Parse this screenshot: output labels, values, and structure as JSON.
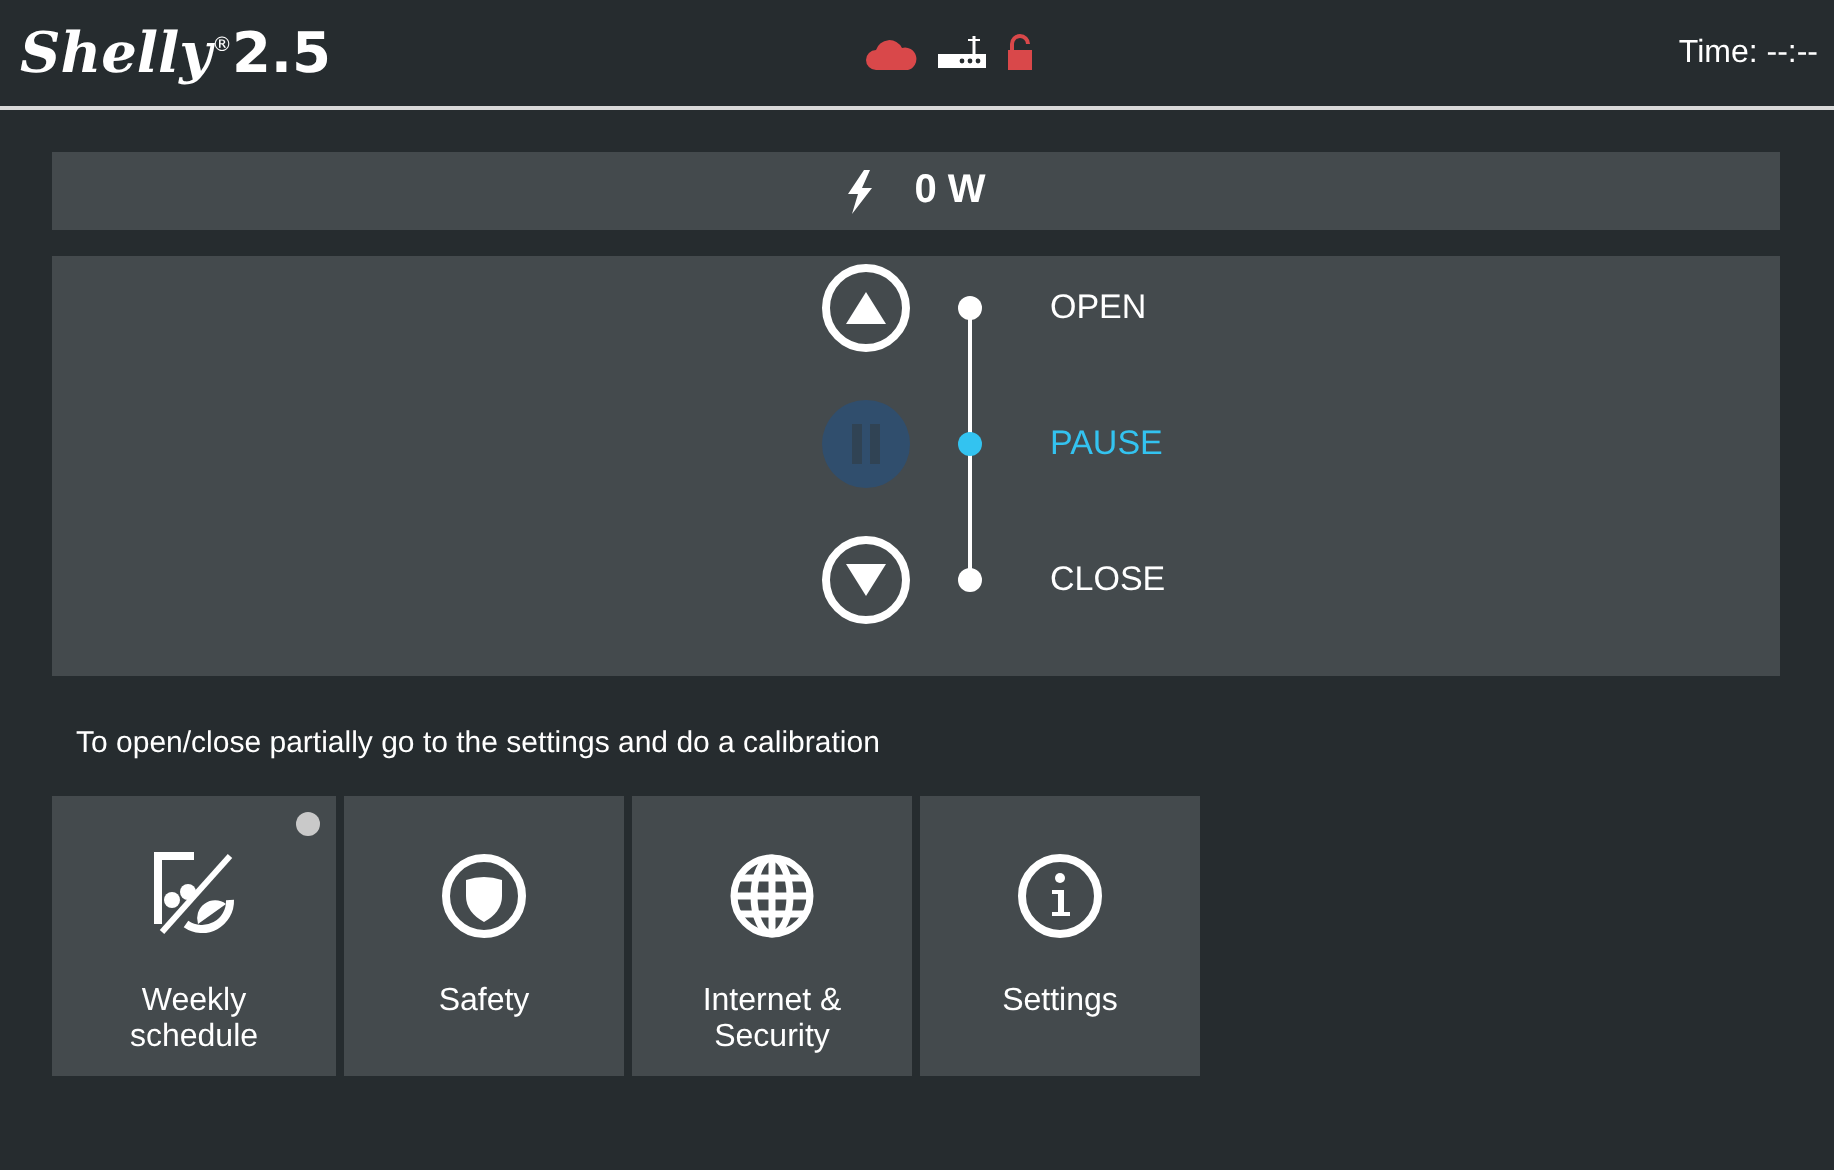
{
  "header": {
    "logo": "Shelly",
    "logo_mark": "®",
    "model": "2.5",
    "status_icons": [
      {
        "kind": "cloud",
        "color": "#d9484a"
      },
      {
        "kind": "router",
        "color": "#ffffff"
      },
      {
        "kind": "lock",
        "color": "#d9484a"
      }
    ],
    "time_label": "Time: --:--"
  },
  "power": {
    "value": "0 W"
  },
  "positions": [
    {
      "kind": "up",
      "label": "OPEN",
      "selected": false
    },
    {
      "kind": "pause",
      "label": "PAUSE",
      "selected": true
    },
    {
      "kind": "down",
      "label": "CLOSE",
      "selected": false
    }
  ],
  "hint": "To open/close partially go to the settings and do a calibration",
  "tiles": [
    {
      "kind": "schedule",
      "label": "Weekly\nschedule",
      "indicator_on": false
    },
    {
      "kind": "shield",
      "label": "Safety"
    },
    {
      "kind": "globe",
      "label": "Internet &\nSecurity"
    },
    {
      "kind": "info",
      "label": "Settings"
    }
  ]
}
